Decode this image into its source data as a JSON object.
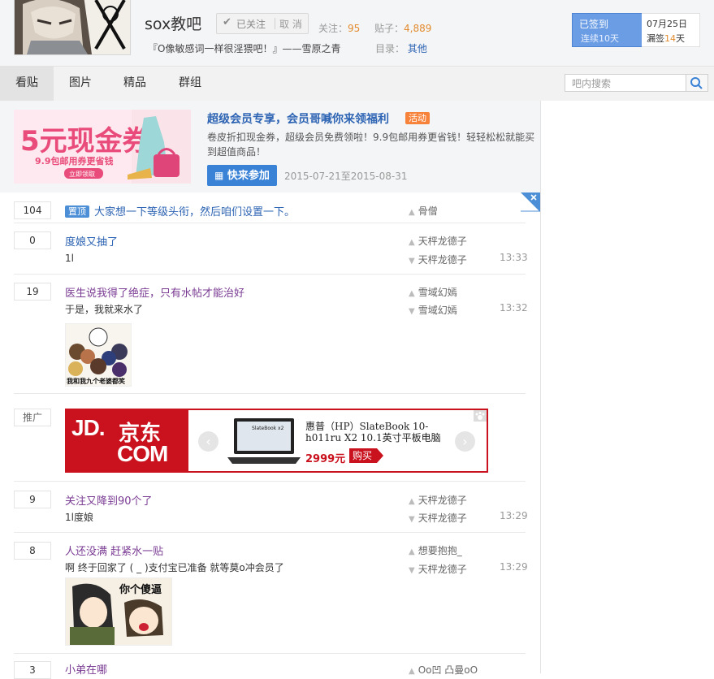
{
  "header": {
    "forum_name": "sox教吧",
    "follow_label": "已关注",
    "cancel_label": "取 消",
    "follow_count_label": "关注：",
    "follow_count": "95",
    "post_count_label": "贴子：",
    "post_count": "4,889",
    "slogan": "『O像敏感词一样很淫猥吧！』——雪原之青",
    "catalog_label": "目录：",
    "catalog_value": "其他",
    "signin_status": "已签到",
    "signin_streak": "连续10天",
    "signin_date": "07月25日",
    "missed_prefix": "漏签",
    "missed_days": "14",
    "missed_suffix": "天"
  },
  "nav": {
    "tabs": [
      {
        "label": "看贴",
        "active": true
      },
      {
        "label": "图片",
        "active": false
      },
      {
        "label": "精品",
        "active": false
      },
      {
        "label": "群组",
        "active": false
      }
    ],
    "search_placeholder": "吧内搜索"
  },
  "promo": {
    "banner_big": "5元现金券",
    "banner_sub": "9.9包邮用券更省钱",
    "banner_btn": "立即领取",
    "title": "超级会员专享，会员哥喊你来领福利",
    "tag": "活动",
    "description": "卷皮折扣现金券，超级会员免费领啦！9.9包邮用券更省钱！轻轻松松就能买到超值商品！",
    "join_label": "快来参加",
    "date_range": "2015-07-21至2015-08-31"
  },
  "threads": [
    {
      "replies": "104",
      "pinned": true,
      "pin_label": "置顶",
      "title": "大家想一下等级头衔，然后咱们设置一下。",
      "author": "骨僧"
    },
    {
      "replies": "0",
      "title": "度娘又抽了",
      "excerpt": "1l",
      "author": "天枰龙德子",
      "last_reply": "天枰龙德子",
      "time": "13:33"
    },
    {
      "replies": "19",
      "title": "医生说我得了绝症，只有水帖才能治好",
      "excerpt": "于是，我就来水了",
      "author": "雪域幻嫣",
      "last_reply": "雪域幻嫣",
      "time": "13:32",
      "image_caption": "我和我九个老婆都笑"
    },
    {
      "replies": "9",
      "title": "关注又降到90个了",
      "excerpt": "1l度娘",
      "author": "天枰龙德子",
      "last_reply": "天枰龙德子",
      "time": "13:29"
    },
    {
      "replies": "8",
      "title": "人还没满 赶紧水一贴",
      "excerpt": "啊 终于回家了 ( _ )支付宝已准备 就等莫o冲会员了",
      "author": "想要抱抱_",
      "last_reply": "天枰龙德子",
      "time": "13:29",
      "image_caption": "你个傻逼"
    },
    {
      "replies": "3",
      "title": "小弟在哪",
      "author": "Oo凹 凸曼oO"
    }
  ],
  "ad": {
    "label": "推广",
    "logo_jd": "JD.",
    "logo_cn": "京东",
    "logo_com": "COM",
    "product_name": "惠普（HP）SlateBook 10-h011ru X2 10.1英寸平板电脑",
    "price": "2999元",
    "buy_label": "购买",
    "screen_text": "SlateBook x2"
  }
}
